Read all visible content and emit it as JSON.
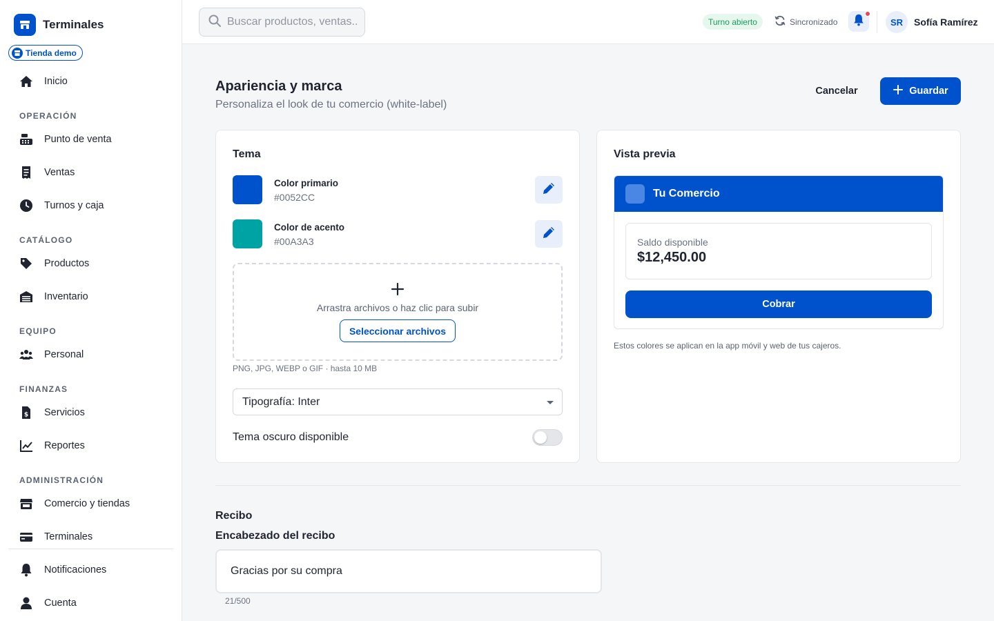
{
  "app": {
    "name": "Terminales",
    "store": "Tienda demo"
  },
  "sidebar": {
    "home": "Inicio",
    "sections": {
      "operacion": "OPERACIÓN",
      "catalogo": "CATÁLOGO",
      "equipo": "EQUIPO",
      "finanzas": "FINANZAS",
      "administracion": "ADMINISTRACIÓN"
    },
    "items": {
      "pos": "Punto de venta",
      "sales": "Ventas",
      "shifts": "Turnos y caja",
      "products": "Productos",
      "inventory": "Inventario",
      "staff": "Personal",
      "services": "Servicios",
      "reports": "Reportes",
      "business": "Comercio y tiendas",
      "terminals": "Terminales",
      "notifications": "Notificaciones",
      "account": "Cuenta"
    }
  },
  "topbar": {
    "search_placeholder": "Buscar productos, ventas...",
    "shift_status": "Turno abierto",
    "sync_status": "Sincronizado",
    "user_initials": "SR",
    "user_name": "Sofía Ramírez"
  },
  "page": {
    "title": "Apariencia y marca",
    "subtitle": "Personaliza el look de tu comercio (white-label)",
    "cancel_label": "Cancelar",
    "save_label": "Guardar"
  },
  "theme": {
    "title": "Tema",
    "primary": {
      "label": "Color primario",
      "hex": "#0052CC",
      "color": "#0052cc"
    },
    "accent": {
      "label": "Color de acento",
      "hex": "#00A3A3",
      "color": "#00a3a3"
    },
    "upload": {
      "text": "Arrastra archivos o haz clic para subir",
      "button": "Seleccionar archivos",
      "hint": "PNG, JPG, WEBP o GIF · hasta 10 MB"
    },
    "font_select": "Tipografía: Inter",
    "dark_mode_label": "Tema oscuro disponible",
    "dark_mode_enabled": false
  },
  "preview": {
    "title": "Vista previa",
    "brand": "Tu Comercio",
    "balance_label": "Saldo disponible",
    "balance_value": "$12,450.00",
    "charge_button": "Cobrar",
    "note": "Estos colores se aplican en la app móvil y web de tus cajeros."
  },
  "receipt": {
    "title": "Recibo",
    "header_label": "Encabezado del recibo",
    "header_value": "Gracias por su compra",
    "char_count": "21/500"
  }
}
